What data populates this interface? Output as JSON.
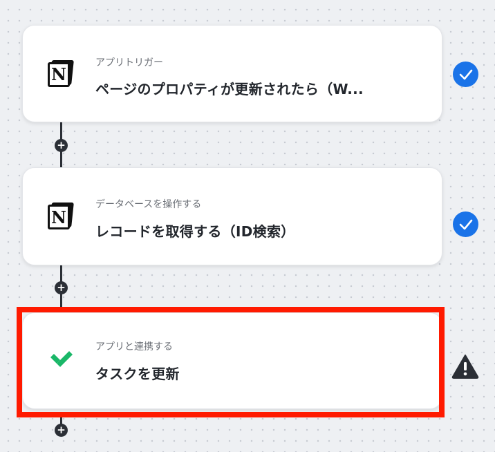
{
  "steps": [
    {
      "subtitle": "アプリトリガー",
      "title": "ページのプロパティが更新されたら（W...",
      "app_icon": "notion-icon",
      "status": "check-icon"
    },
    {
      "subtitle": "データベースを操作する",
      "title": "レコードを取得する（ID検索）",
      "app_icon": "notion-icon",
      "status": "check-icon"
    },
    {
      "subtitle": "アプリと連携する",
      "title": "タスクを更新",
      "app_icon": "wrike-icon",
      "status": "warning-icon"
    }
  ],
  "add_step_symbol": "+",
  "notion_letter": "N",
  "colors": {
    "highlight": "#ff1a00",
    "check": "#1a73e8",
    "wrike": "#1ab768",
    "warning": "#2b2f36"
  }
}
